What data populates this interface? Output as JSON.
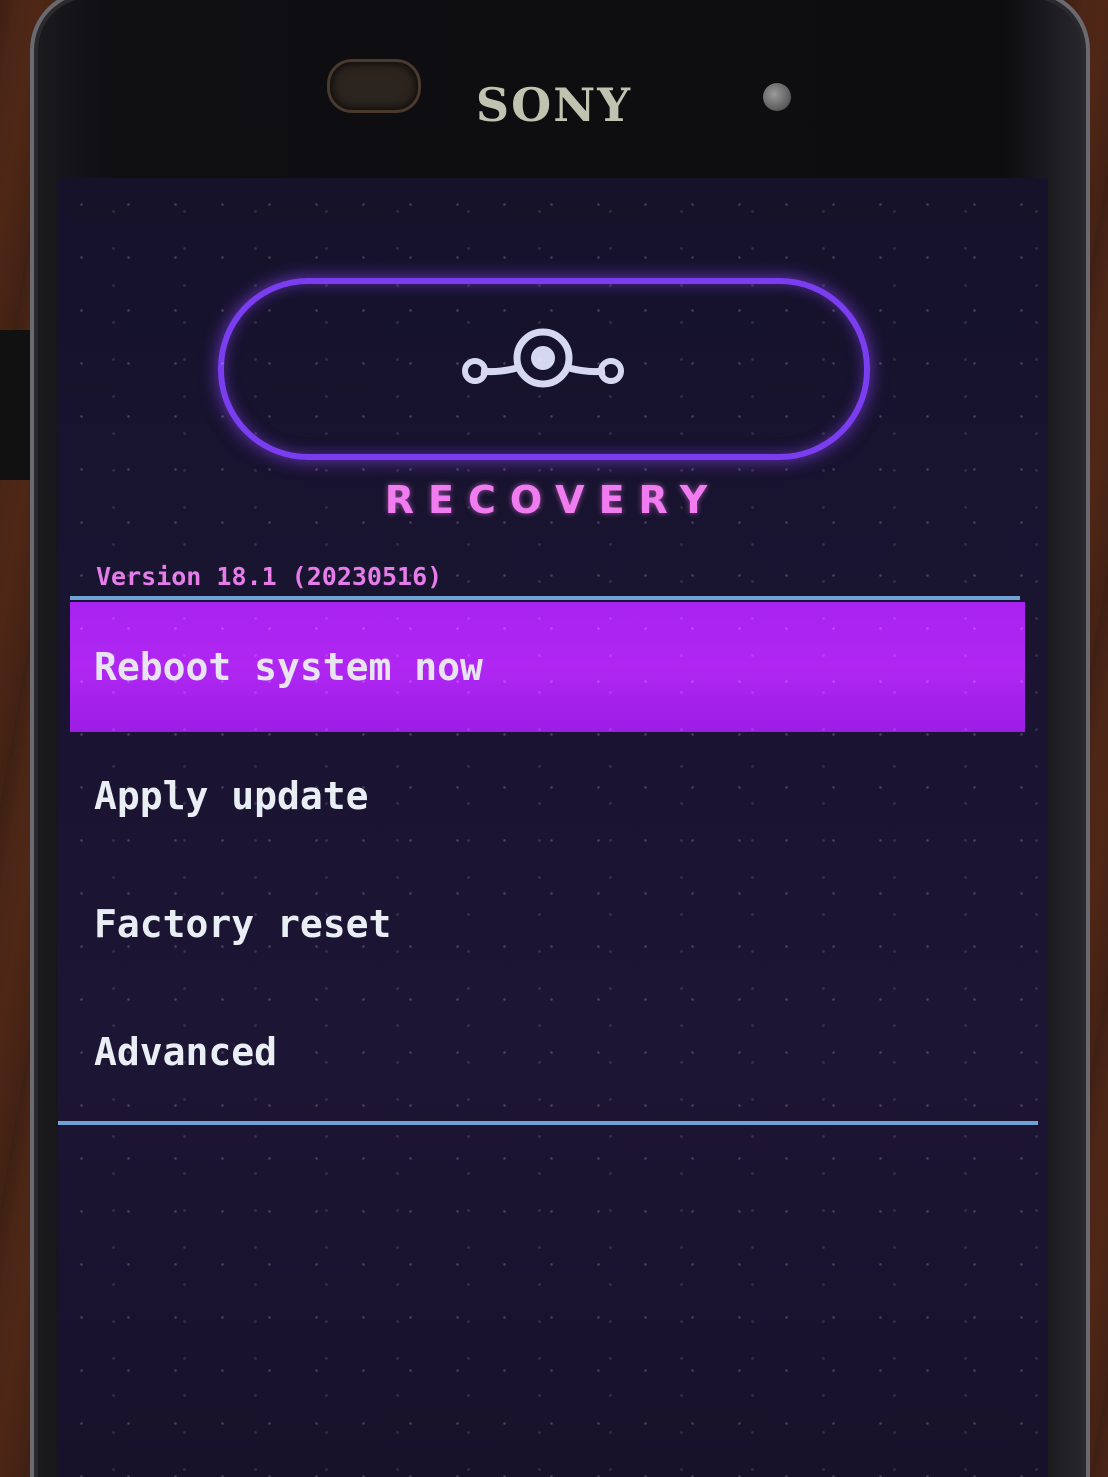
{
  "device": {
    "brand": "SONY"
  },
  "header": {
    "logo": "lineageos-logo-icon",
    "title": "RECOVERY",
    "version": "Version 18.1 (20230516)"
  },
  "menu": {
    "items": [
      {
        "label": "Reboot system now",
        "selected": true
      },
      {
        "label": "Apply update",
        "selected": false
      },
      {
        "label": "Factory reset",
        "selected": false
      },
      {
        "label": "Advanced",
        "selected": false
      }
    ]
  },
  "colors": {
    "accent": "#7b3df0",
    "title": "#f07cf0",
    "selection": "#a822f0",
    "divider": "#6fa3d6",
    "text": "#e9eef4"
  }
}
